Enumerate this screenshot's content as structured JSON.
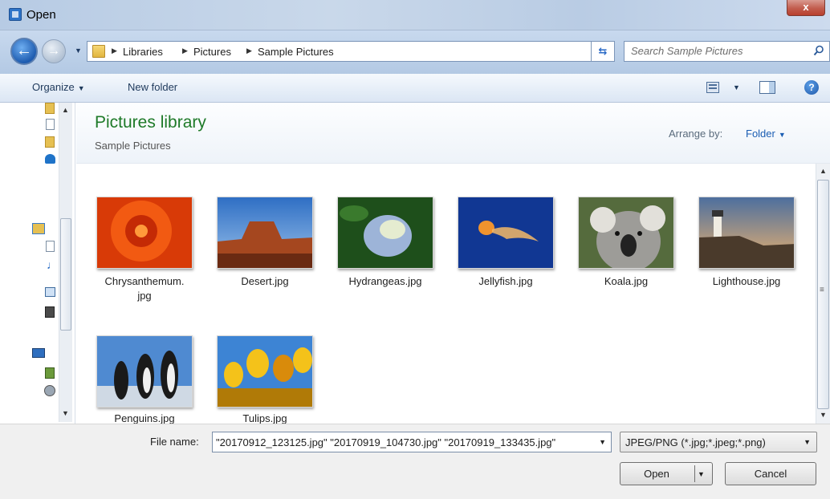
{
  "window": {
    "title": "Open",
    "close_label": "x"
  },
  "address": {
    "crumbs": [
      "Libraries",
      "Pictures",
      "Sample Pictures"
    ]
  },
  "search": {
    "placeholder": "Search Sample Pictures"
  },
  "toolbar": {
    "organize_label": "Organize",
    "new_folder_label": "New folder",
    "help_label": "?"
  },
  "library": {
    "title": "Pictures library",
    "subtitle": "Sample Pictures",
    "arrange_label": "Arrange by:",
    "arrange_value": "Folder"
  },
  "files": [
    {
      "name": "Chrysanthemum.",
      "name2": "jpg",
      "colors": [
        "#c42a05",
        "#f25a12",
        "#ff8a2a"
      ]
    },
    {
      "name": "Desert.jpg",
      "colors": [
        "#3b79c4",
        "#a5471f",
        "#5a2010"
      ]
    },
    {
      "name": "Hydrangeas.jpg",
      "colors": [
        "#1e4f1b",
        "#9db4d8",
        "#e5ecd0"
      ]
    },
    {
      "name": "Jellyfish.jpg",
      "colors": [
        "#0c2a7a",
        "#1d4fc3",
        "#f0932e"
      ]
    },
    {
      "name": "Koala.jpg",
      "colors": [
        "#556b3d",
        "#9d9c98",
        "#e2e0da"
      ]
    },
    {
      "name": "Lighthouse.jpg",
      "colors": [
        "#4d6f9e",
        "#f5b66c",
        "#4a3a2b"
      ]
    },
    {
      "name": "Penguins.jpg",
      "colors": [
        "#4f8ad1",
        "#1a1a1a",
        "#cfd9e4"
      ]
    },
    {
      "name": "Tulips.jpg",
      "colors": [
        "#3d84d4",
        "#f4c21a",
        "#d98b0b"
      ]
    }
  ],
  "bottom": {
    "file_name_label": "File name:",
    "file_name_value": "\"20170912_123125.jpg\" \"20170919_104730.jpg\" \"20170919_133435.jpg\"",
    "filter_value": "JPEG/PNG (*.jpg;*.jpeg;*.png)",
    "open_label": "Open",
    "cancel_label": "Cancel"
  }
}
